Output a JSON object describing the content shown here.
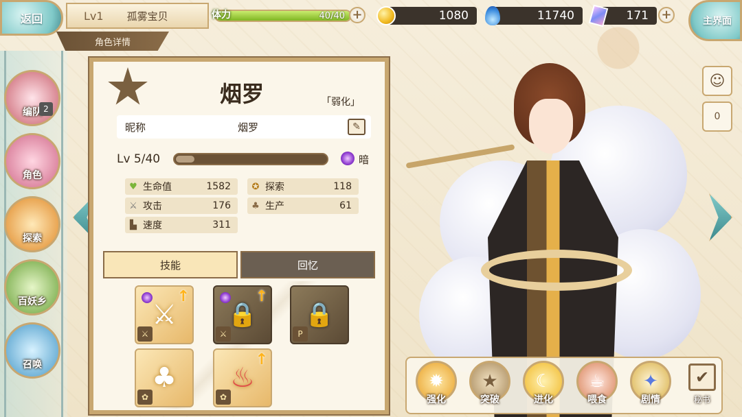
{
  "topbar": {
    "back_label": "返回",
    "level": "Lv1",
    "player_name": "孤雾宝贝",
    "section_title": "角色详情",
    "stamina_label": "体力",
    "stamina_value": "40/40",
    "stamina_fraction": 1.0,
    "coins": "1080",
    "soul_fire": "11740",
    "gems": "171",
    "home_label": "主界面",
    "plus_symbol": "+"
  },
  "left_nav": {
    "items": [
      {
        "label": "编队",
        "badge": "2",
        "icon": "team-icon"
      },
      {
        "label": "角色",
        "icon": "character-icon"
      },
      {
        "label": "探索",
        "icon": "explore-icon"
      },
      {
        "label": "百妖乡",
        "icon": "village-icon"
      },
      {
        "label": "召唤",
        "icon": "summon-icon"
      }
    ]
  },
  "character": {
    "name": "烟罗",
    "tag": "「弱化」",
    "nickname_label": "昵称",
    "nickname": "烟罗",
    "level_label": "Lv 5/40",
    "level_fraction": 0.125,
    "attribute": "暗",
    "stats": [
      {
        "label": "生命值",
        "value": "1582",
        "icon": "heart-icon",
        "glyph": "♥"
      },
      {
        "label": "攻击",
        "value": "176",
        "icon": "sword-icon",
        "glyph": "⚔"
      },
      {
        "label": "速度",
        "value": "311",
        "icon": "boot-icon",
        "glyph": "👢"
      },
      {
        "label": "探索",
        "value": "118",
        "icon": "compass-icon",
        "glyph": "✪"
      },
      {
        "label": "生产",
        "value": "61",
        "icon": "bag-icon",
        "glyph": "♣"
      }
    ]
  },
  "tabs": {
    "skills": "技能",
    "memories": "回忆"
  },
  "skills": [
    {
      "state": "unlocked",
      "icon": "sword-skill-icon",
      "glyph": "⚔",
      "corner": "⚔"
    },
    {
      "state": "locked",
      "icon": "lock-icon",
      "glyph": "🔒",
      "corner": "⚔"
    },
    {
      "state": "locked",
      "icon": "lock-icon",
      "glyph": "🔒",
      "corner": "P"
    },
    {
      "state": "unlocked",
      "icon": "bag-skill-icon",
      "glyph": "♣",
      "corner": "✿"
    },
    {
      "state": "unlocked",
      "icon": "meat-skill-icon",
      "glyph": "♨",
      "corner": "✿"
    }
  ],
  "side_buttons": {
    "emote": "☺",
    "likes": "0"
  },
  "actions": [
    {
      "label": "强化",
      "icon": "enhance-icon",
      "glyph": "✹"
    },
    {
      "label": "突破",
      "icon": "breakthrough-icon",
      "glyph": "★"
    },
    {
      "label": "进化",
      "icon": "evolve-icon",
      "glyph": "☾"
    },
    {
      "label": "喂食",
      "icon": "feed-icon",
      "glyph": "☕"
    },
    {
      "label": "剧情",
      "icon": "story-icon",
      "glyph": "✦"
    }
  ],
  "book": {
    "label": "秘书",
    "glyph": "✔"
  }
}
